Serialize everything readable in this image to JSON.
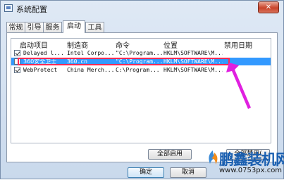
{
  "window": {
    "title": "系统配置",
    "close_glyph": "✕"
  },
  "tabs": [
    {
      "label": "常规",
      "active": false
    },
    {
      "label": "引导",
      "active": false
    },
    {
      "label": "服务",
      "active": false
    },
    {
      "label": "启动",
      "active": true
    },
    {
      "label": "工具",
      "active": false
    }
  ],
  "startup_list": {
    "columns": [
      "启动项目",
      "制造商",
      "命令",
      "位置",
      "禁用日期"
    ],
    "rows": [
      {
        "checked": true,
        "item": "Delayed l...",
        "maker": "Intel Corpo...",
        "command": "\"C:\\Program...",
        "location": "HKLM\\SOFTWARE\\M...",
        "disabled_date": ""
      },
      {
        "checked": false,
        "item": "360安全卫士",
        "maker": "360.cn",
        "command": "\"C:\\Program...",
        "location": "HKLM\\SOFTWARE\\M...",
        "disabled_date": "",
        "selected": true
      },
      {
        "checked": true,
        "item": "WebProtect",
        "maker": "China Merch...",
        "command": "C:\\Program...",
        "location": "HKLM\\SOFTWARE\\M...",
        "disabled_date": ""
      }
    ]
  },
  "buttons": {
    "enable_all": "全部启用",
    "disable_all": "全部禁用(",
    "ok": "确定",
    "cancel": "取消"
  },
  "watermark": {
    "text": "鹏鑫装机网",
    "url": "www.0753px.com"
  },
  "colors": {
    "selection": "#3399ff",
    "annotation": "#ff2a55",
    "arrow": "#e020e0"
  }
}
